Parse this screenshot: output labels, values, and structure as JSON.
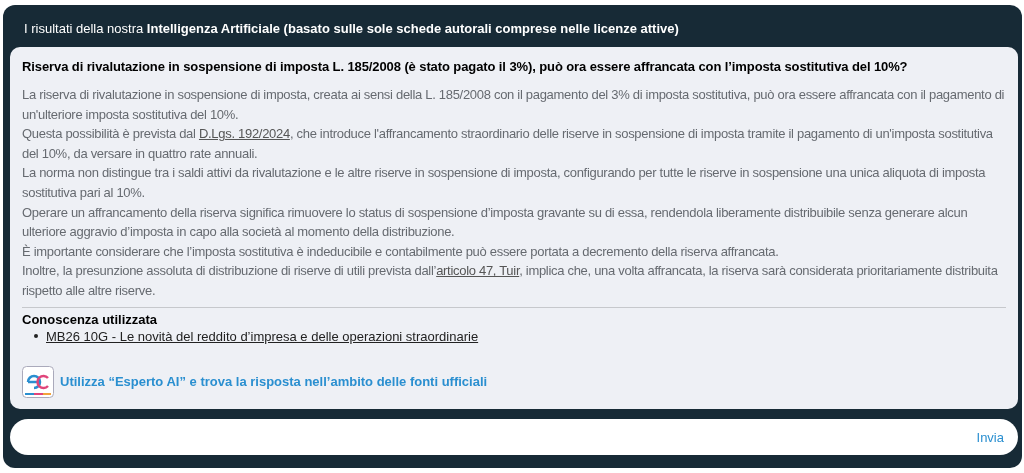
{
  "header": {
    "title": "I risultati della nostra **Intelligenza Artificiale (basato sulle sole schede autorali comprese nelle licenze attive)**"
  },
  "answer": {
    "question": "Riserva di rivalutazione in sospensione di imposta L. 185/2008 (è stato pagato il 3%), può ora essere affrancata con l’imposta sostitutiva del 10%?",
    "paragraphs": [
      [
        {
          "kind": "text",
          "text": "La riserva di rivalutazione in sospensione di imposta, creata ai sensi della L. 185/2008 con il pagamento del 3% di imposta sostitutiva, può ora essere affrancata con il pagamento di un'ulteriore imposta sostitutiva del 10%."
        }
      ],
      [
        {
          "kind": "text",
          "text": "Questa possibilità è prevista dal "
        },
        {
          "kind": "link",
          "text": "D.Lgs. 192/2024"
        },
        {
          "kind": "text",
          "text": ", che introduce l'affrancamento straordinario delle riserve in sospensione di imposta tramite il pagamento di un'imposta sostitutiva del 10%, da versare in quattro rate annuali."
        }
      ],
      [
        {
          "kind": "text",
          "text": "La norma non distingue tra i saldi attivi da rivalutazione e le altre riserve in sospensione di imposta, configurando per tutte le riserve in sospensione una unica aliquota di imposta sostitutiva pari al 10%."
        }
      ],
      [
        {
          "kind": "text",
          "text": "Operare un affrancamento della riserva significa rimuovere lo status di sospensione d’imposta gravante su di essa, rendendola liberamente distribuibile senza generare alcun ulteriore aggravio d’imposta in capo alla società al momento della distribuzione."
        }
      ],
      [
        {
          "kind": "text",
          "text": "È importante considerare che l’imposta sostitutiva è indeducibile e contabilmente può essere portata a decremento della riserva affrancata."
        }
      ],
      [
        {
          "kind": "text",
          "text": "Inoltre, la presunzione assoluta di distribuzione di riserve di utili prevista dall’"
        },
        {
          "kind": "link",
          "text": "articolo 47, Tuir"
        },
        {
          "kind": "text",
          "text": ", implica che, una volta affrancata, la riserva sarà considerata prioritariamente distribuita rispetto alle altre riserve."
        }
      ]
    ],
    "knowledge": {
      "title": "Conoscenza utilizzata",
      "items": [
        "MB26 10G - Le novità del reddito d’impresa e delle operazioni straordinarie"
      ]
    },
    "promo": "Utilizza “Esperto AI” e trova la risposta nell’ambito delle fonti ufficiali"
  },
  "composer": {
    "send": "Invia"
  }
}
